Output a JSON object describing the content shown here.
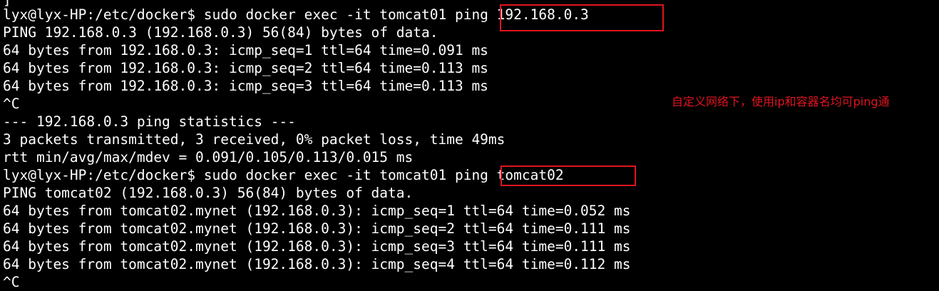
{
  "terminal": {
    "lines": [
      "]",
      "lyx@lyx-HP:/etc/docker$ sudo docker exec -it tomcat01 ping 192.168.0.3",
      "PING 192.168.0.3 (192.168.0.3) 56(84) bytes of data.",
      "64 bytes from 192.168.0.3: icmp_seq=1 ttl=64 time=0.091 ms",
      "64 bytes from 192.168.0.3: icmp_seq=2 ttl=64 time=0.113 ms",
      "64 bytes from 192.168.0.3: icmp_seq=3 ttl=64 time=0.113 ms",
      "^C",
      "--- 192.168.0.3 ping statistics ---",
      "3 packets transmitted, 3 received, 0% packet loss, time 49ms",
      "rtt min/avg/max/mdev = 0.091/0.105/0.113/0.015 ms",
      "lyx@lyx-HP:/etc/docker$ sudo docker exec -it tomcat01 ping tomcat02",
      "PING tomcat02 (192.168.0.3) 56(84) bytes of data.",
      "64 bytes from tomcat02.mynet (192.168.0.3): icmp_seq=1 ttl=64 time=0.052 ms",
      "64 bytes from tomcat02.mynet (192.168.0.3): icmp_seq=2 ttl=64 time=0.111 ms",
      "64 bytes from tomcat02.mynet (192.168.0.3): icmp_seq=3 ttl=64 time=0.111 ms",
      "64 bytes from tomcat02.mynet (192.168.0.3): icmp_seq=4 ttl=64 time=0.112 ms",
      "^C"
    ]
  },
  "annotation": {
    "text": "自定义网络下，使用ip和容器名均可ping通"
  },
  "colors": {
    "background": "#000000",
    "text": "#ffffff",
    "highlight": "#e0141f"
  }
}
